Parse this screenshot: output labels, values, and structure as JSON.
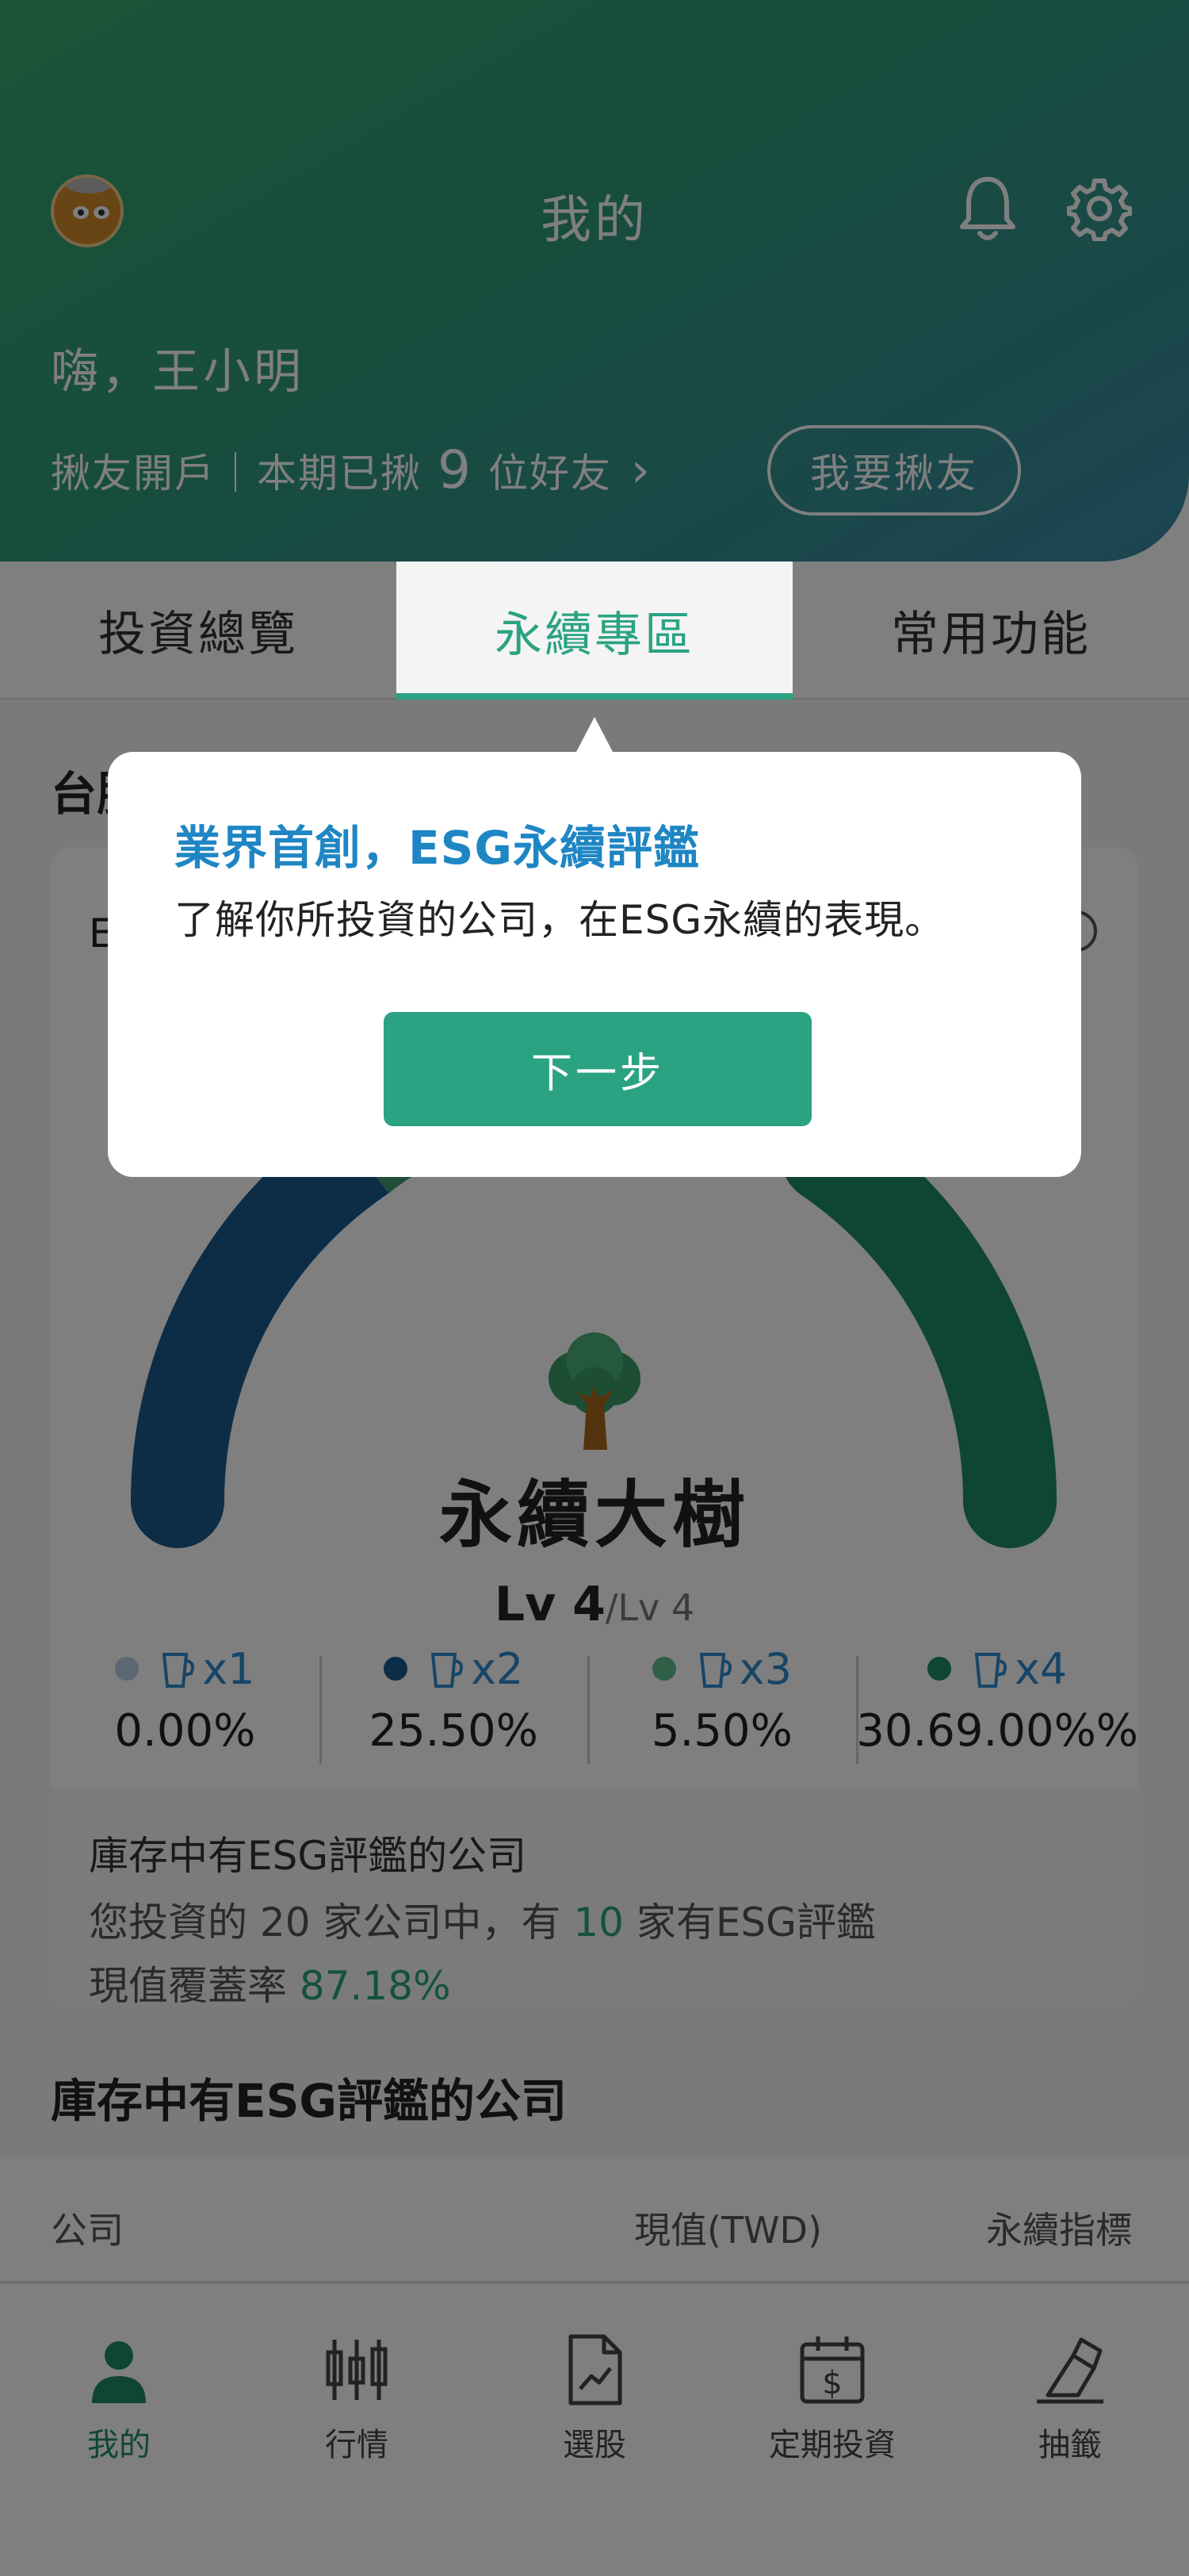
{
  "header": {
    "title": "我的",
    "greeting": "嗨，王小明",
    "invite_prefix": "揪友開戶｜本期已揪",
    "invite_count": "9",
    "invite_suffix": "位好友",
    "invite_button": "我要揪友",
    "icons": [
      "avatar",
      "bell-icon",
      "gear-icon"
    ]
  },
  "tabs": [
    {
      "label": "投資總覽"
    },
    {
      "label": "永續專區"
    },
    {
      "label": "常用功能"
    }
  ],
  "main": {
    "section_a_title": "台股",
    "card": {
      "head_label": "E",
      "level_name": "永續大樹",
      "level_current": "Lv 4",
      "level_max": "/Lv 4",
      "stats": [
        {
          "mult": "x1",
          "pct": "0.00%",
          "color": "#b7cfe6"
        },
        {
          "mult": "x2",
          "pct": "25.50%",
          "color": "#1b5b8f"
        },
        {
          "mult": "x3",
          "pct": "5.50%",
          "color": "#5fbf8f"
        },
        {
          "mult": "x4",
          "pct": "30.69.00%%",
          "color": "#1f8a6b"
        }
      ],
      "foot": {
        "heading": "庫存中有ESG評鑑的公司",
        "line1_a": "您投資的 20 家公司中，有 ",
        "line1_num": "10",
        "line1_b": " 家有ESG評鑑",
        "line2_a": "現值覆蓋率 ",
        "line2_pct": "87.18%"
      }
    },
    "section_b_title": "庫存中有ESG評鑑的公司",
    "table_headers": [
      "公司",
      "現值(TWD)",
      "永續指標"
    ]
  },
  "bottom_nav": [
    {
      "label": "我的",
      "icon": "person-icon"
    },
    {
      "label": "行情",
      "icon": "candlestick-icon"
    },
    {
      "label": "選股",
      "icon": "document-chart-icon"
    },
    {
      "label": "定期投資",
      "icon": "calendar-dollar-icon"
    },
    {
      "label": "抽籤",
      "icon": "lottery-icon"
    }
  ],
  "popup": {
    "title": "業界首創，ESG永續評鑑",
    "description": "了解你所投資的公司，在ESG永續的表現。",
    "next_button": "下一步"
  },
  "colors": {
    "accent": "#2ba383",
    "popup_title": "#1f86c4",
    "gauge_blue": "#1b5b8f",
    "gauge_green": "#1f8a6b"
  }
}
